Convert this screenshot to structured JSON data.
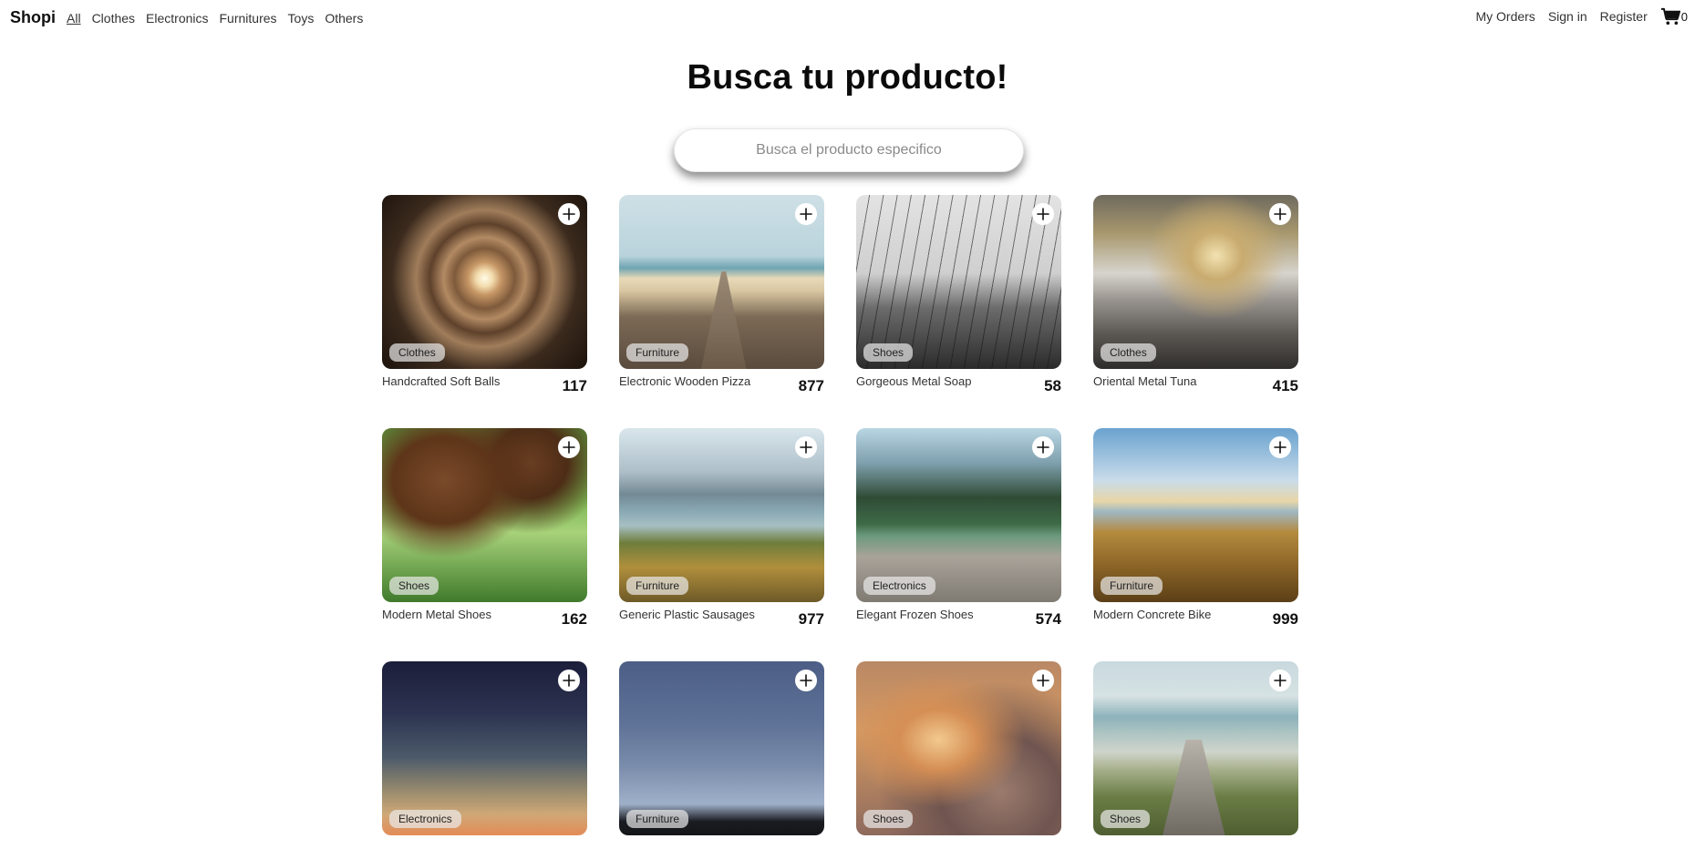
{
  "navbar": {
    "brand": "Shopi",
    "categories": [
      "All",
      "Clothes",
      "Electronics",
      "Furnitures",
      "Toys",
      "Others"
    ],
    "active_category": "All",
    "right_links": [
      "My Orders",
      "Sign in",
      "Register"
    ],
    "cart_icon": "shopping-cart-icon",
    "cart_count": "0"
  },
  "hero": {
    "title": "Busca tu producto!",
    "search_placeholder": "Busca el producto especifico"
  },
  "products": [
    {
      "name": "Handcrafted Soft Balls",
      "price": "117",
      "category": "Clothes",
      "image": "tunnel"
    },
    {
      "name": "Electronic Wooden Pizza",
      "price": "877",
      "category": "Furniture",
      "image": "pier"
    },
    {
      "name": "Gorgeous Metal Soap",
      "price": "58",
      "category": "Shoes",
      "image": "wires"
    },
    {
      "name": "Oriental Metal Tuna",
      "price": "415",
      "category": "Clothes",
      "image": "rocks"
    },
    {
      "name": "Modern Metal Shoes",
      "price": "162",
      "category": "Shoes",
      "image": "dogs"
    },
    {
      "name": "Generic Plastic Sausages",
      "price": "977",
      "category": "Furniture",
      "image": "lake"
    },
    {
      "name": "Elegant Frozen Shoes",
      "price": "574",
      "category": "Electronics",
      "image": "dock"
    },
    {
      "name": "Modern Concrete Bike",
      "price": "999",
      "category": "Furniture",
      "image": "swing"
    },
    {
      "name": "",
      "price": "",
      "category": "Electronics",
      "image": "dusk"
    },
    {
      "name": "",
      "price": "",
      "category": "Furniture",
      "image": "city"
    },
    {
      "name": "",
      "price": "",
      "category": "Shoes",
      "image": "clouds"
    },
    {
      "name": "",
      "price": "",
      "category": "Shoes",
      "image": "beach"
    }
  ],
  "add_icon": "plus-icon"
}
